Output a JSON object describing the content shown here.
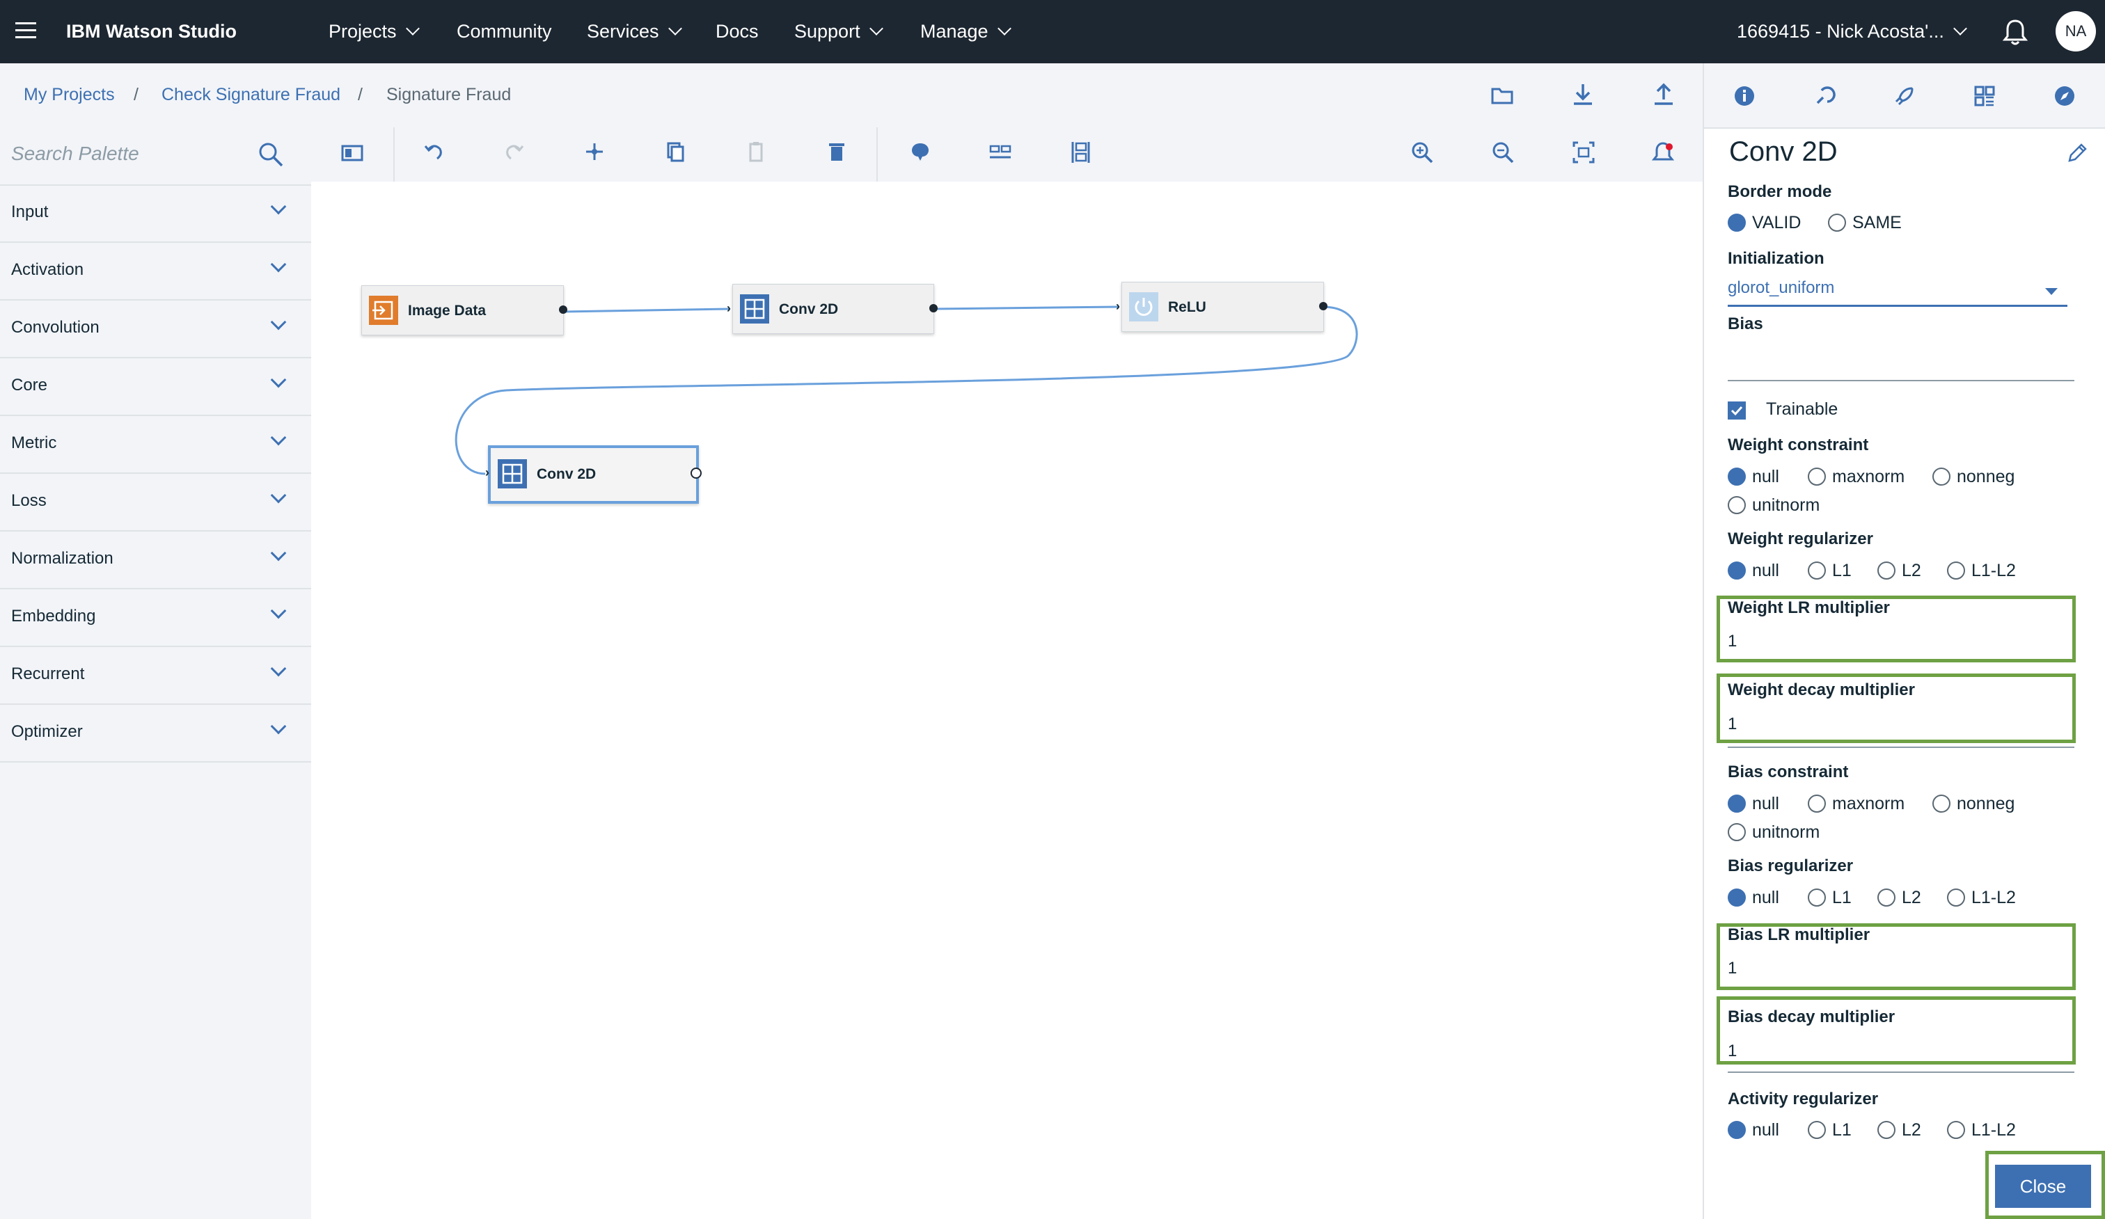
{
  "topnav": {
    "app_title": "IBM Watson Studio",
    "items": [
      {
        "label": "Projects",
        "has_dropdown": true
      },
      {
        "label": "Community",
        "has_dropdown": false
      },
      {
        "label": "Services",
        "has_dropdown": true
      },
      {
        "label": "Docs",
        "has_dropdown": false
      },
      {
        "label": "Support",
        "has_dropdown": true
      },
      {
        "label": "Manage",
        "has_dropdown": true
      }
    ],
    "account": "1669415 - Nick Acosta'...",
    "avatar_initials": "NA",
    "icons": [
      "hamburger-menu-icon",
      "notification-bell-icon"
    ]
  },
  "breadcrumb": {
    "items": [
      "My Projects",
      "Check Signature Fraud",
      "Signature Fraud"
    ],
    "separator": "/",
    "actions": [
      "folder-icon",
      "download-icon",
      "upload-icon"
    ]
  },
  "panel_tabs": [
    "info-icon",
    "palette-tool-icon",
    "deploy-rocket-icon",
    "grid-layout-icon",
    "compass-icon"
  ],
  "palette": {
    "search_placeholder": "Search Palette",
    "categories": [
      "Input",
      "Activation",
      "Convolution",
      "Core",
      "Metric",
      "Loss",
      "Normalization",
      "Embedding",
      "Recurrent",
      "Optimizer"
    ]
  },
  "toolbar": {
    "icons": [
      "sidebar-toggle-icon",
      "undo-icon",
      "redo-icon",
      "arrange-icon",
      "copy-icon",
      "paste-icon",
      "delete-icon",
      "comment-icon",
      "horizontal-align-icon",
      "vertical-align-icon",
      "zoom-in-icon",
      "zoom-out-icon",
      "fit-to-screen-icon",
      "notifications-icon"
    ]
  },
  "canvas": {
    "nodes": [
      {
        "label": "Image Data",
        "icon": "import-icon",
        "color": "#e07c2c"
      },
      {
        "label": "Conv 2D",
        "icon": "grid-icon",
        "color": "#3d70b2"
      },
      {
        "label": "ReLU",
        "icon": "power-icon",
        "color": "#bcd6ee"
      },
      {
        "label": "Conv 2D",
        "icon": "grid-icon",
        "color": "#3d70b2",
        "selected": true
      }
    ]
  },
  "properties": {
    "title": "Conv 2D",
    "border_mode": {
      "label": "Border mode",
      "options": [
        "VALID",
        "SAME"
      ],
      "selected": "VALID"
    },
    "initialization": {
      "label": "Initialization",
      "value": "glorot_uniform"
    },
    "bias": {
      "label": "Bias",
      "value": ""
    },
    "trainable": {
      "label": "Trainable",
      "checked": true
    },
    "weight_constraint": {
      "label": "Weight constraint",
      "options": [
        "null",
        "maxnorm",
        "nonneg",
        "unitnorm"
      ],
      "selected": "null"
    },
    "weight_regularizer": {
      "label": "Weight regularizer",
      "options": [
        "null",
        "L1",
        "L2",
        "L1-L2"
      ],
      "selected": "null"
    },
    "weight_lr_multiplier": {
      "label": "Weight LR multiplier",
      "value": "1"
    },
    "weight_decay_multiplier": {
      "label": "Weight decay multiplier",
      "value": "1"
    },
    "bias_constraint": {
      "label": "Bias constraint",
      "options": [
        "null",
        "maxnorm",
        "nonneg",
        "unitnorm"
      ],
      "selected": "null"
    },
    "bias_regularizer": {
      "label": "Bias regularizer",
      "options": [
        "null",
        "L1",
        "L2",
        "L1-L2"
      ],
      "selected": "null"
    },
    "bias_lr_multiplier": {
      "label": "Bias LR multiplier",
      "value": "1"
    },
    "bias_decay_multiplier": {
      "label": "Bias decay multiplier",
      "value": "1"
    },
    "activity_regularizer": {
      "label": "Activity regularizer",
      "options": [
        "null",
        "L1",
        "L2",
        "L1-L2"
      ],
      "selected": "null"
    },
    "close_label": "Close"
  },
  "colors": {
    "nav_bg": "#1d2731",
    "accent": "#3d70b2",
    "highlight": "#6ea143",
    "panel_bg": "#f2f4f8"
  }
}
